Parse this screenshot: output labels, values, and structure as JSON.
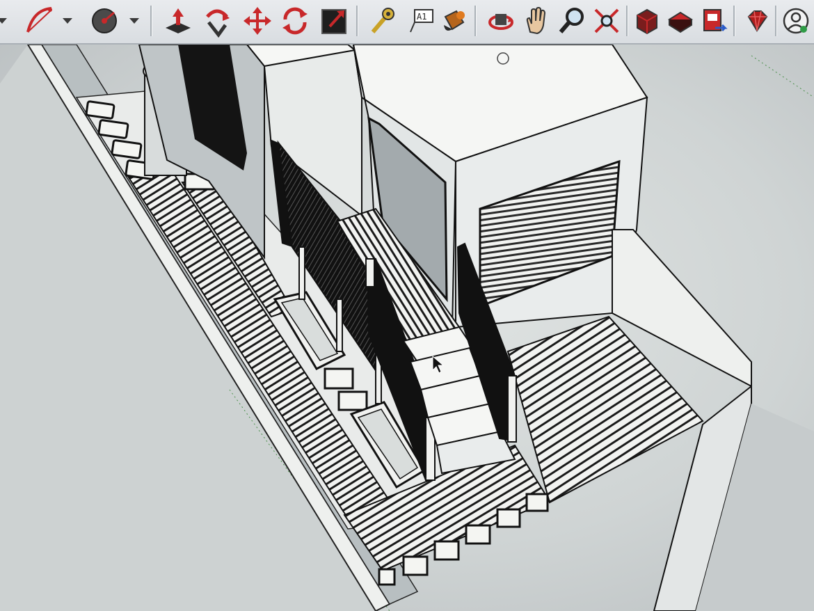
{
  "toolbar": {
    "text_tool_glyph": "A1",
    "tools": [
      "arc-tool",
      "select-dropdown",
      "pie-tool",
      "pie-dropdown",
      "push-pull-tool",
      "follow-me-tool",
      "move-tool",
      "rotate-tool",
      "scale-tool",
      "tape-measure-tool",
      "text-tool",
      "paint-bucket-tool",
      "orbit-tool",
      "pan-tool",
      "zoom-tool",
      "zoom-extents-tool",
      "warehouse-tool",
      "extension-warehouse-tool",
      "layout-send-tool",
      "ruby-tool",
      "account-tool"
    ]
  },
  "colors": {
    "toolbar_bg": "#e2e5e9",
    "red_accent": "#c8282a",
    "dark_icon": "#3a3a3a",
    "model_face": "#f4f5f2",
    "model_shade": "#aeb5b8",
    "model_dark": "#161616",
    "sky": "#d6dbdb"
  }
}
